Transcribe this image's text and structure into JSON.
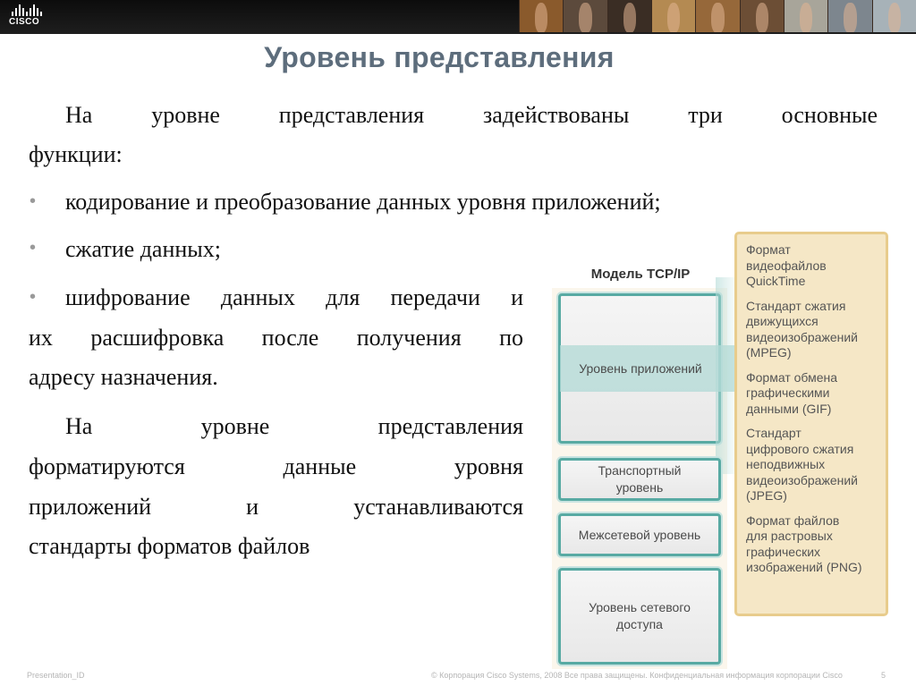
{
  "header": {
    "logo_text": "CISCO"
  },
  "slide": {
    "title": "Уровень представления",
    "intro_line1": "На уровне представления задействованы три основные",
    "intro_line2": "функции:",
    "bullets": [
      {
        "text": "кодирование и преобразование данных уровня приложений;"
      },
      {
        "text": "сжатие данных;"
      },
      {
        "line1": "шифрование данных для передачи и",
        "line2": "их расшифровка после получения по",
        "line3": "адресу назначения."
      }
    ],
    "closing_lines": [
      "На уровне представления",
      "форматируются данные уровня",
      "приложений и устанавливаются",
      "стандарты форматов файлов"
    ]
  },
  "diagram": {
    "model_title": "Модель TCP/IP",
    "layers": {
      "application": "Уровень приложений",
      "transport_line1": "Транспортный",
      "transport_line2": "уровень",
      "internet": "Межсетевой уровень",
      "network_line1": "Уровень сетевого",
      "network_line2": "доступа"
    },
    "formats": [
      [
        "Формат",
        "видеофайлов",
        "QuickTime"
      ],
      [
        "Стандарт сжатия",
        "движущихся",
        "видеоизображений",
        "(MPEG)"
      ],
      [
        "Формат обмена",
        "графическими",
        "данными (GIF)"
      ],
      [
        "Стандарт",
        "цифрового сжатия",
        "неподвижных",
        "видеоизображений",
        "(JPEG)"
      ],
      [
        "Формат файлов",
        "для растровых",
        "графических",
        "изображений (PNG)"
      ]
    ]
  },
  "footer": {
    "presentation_id": "Presentation_ID",
    "copyright": "© Корпорация Cisco Systems, 2008 Все права защищены. Конфиденциальная информация корпорации Cisco",
    "page_number": "5"
  },
  "colors": {
    "title": "#5d6d7c",
    "layer_border": "#58aaa3",
    "formats_bg": "#f5e7c6",
    "formats_border": "#e8cc8c"
  }
}
